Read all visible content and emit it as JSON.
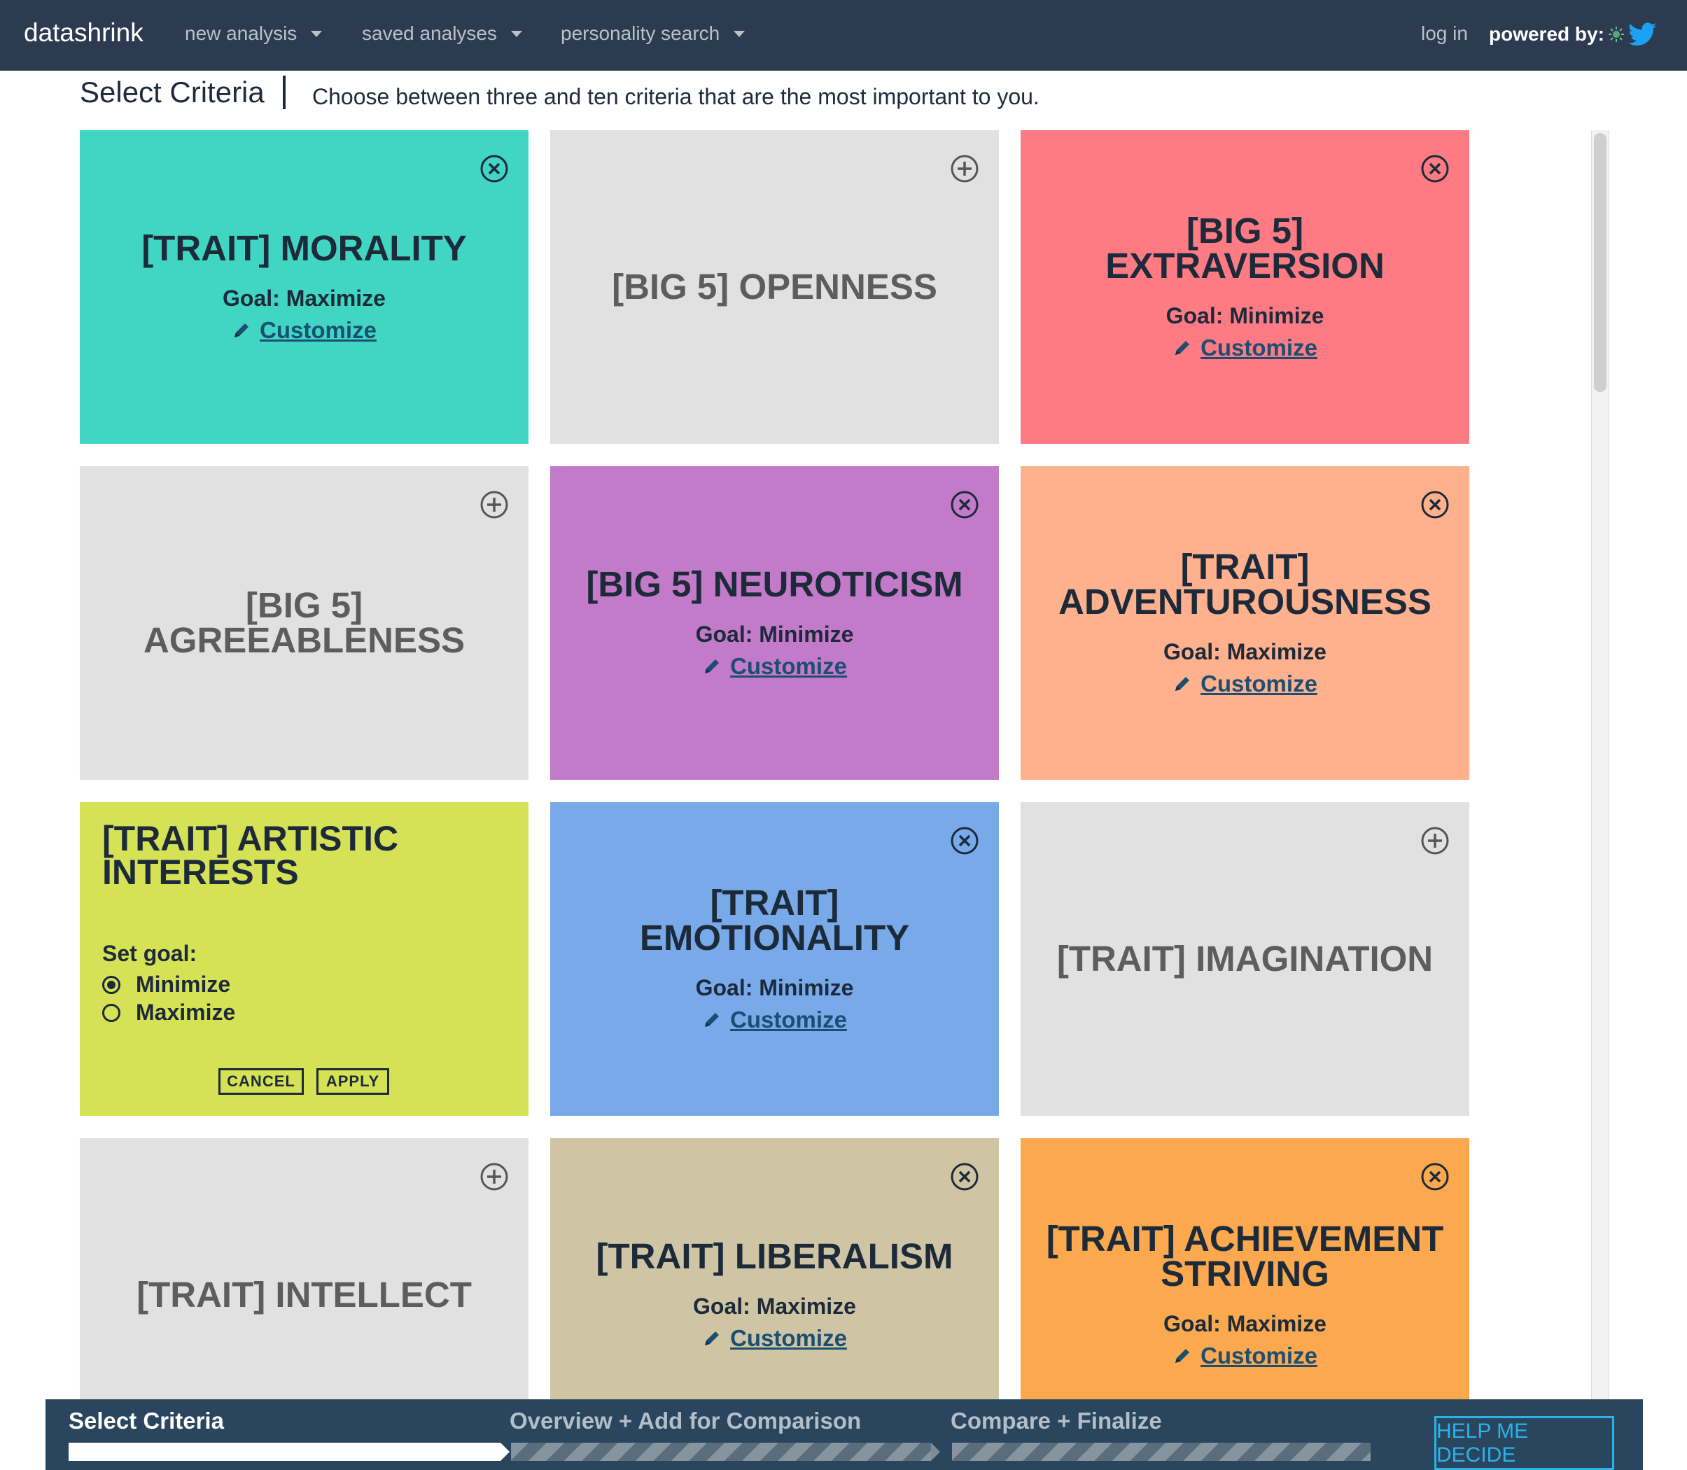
{
  "navbar": {
    "brand": "datashrink",
    "menus": [
      {
        "label": "new analysis"
      },
      {
        "label": "saved analyses"
      },
      {
        "label": "personality search"
      }
    ],
    "login": "log in",
    "powered_by": "powered by:"
  },
  "header": {
    "title": "Select Criteria",
    "subtitle": "Choose between three and ten criteria that are the most important to you."
  },
  "cards": [
    {
      "title": "[TRAIT] MORALITY",
      "goal": "Goal: Maximize",
      "customize": "Customize",
      "selected": true,
      "color": "#41d6c3"
    },
    {
      "title": "[BIG 5] OPENNESS",
      "selected": false,
      "color": "#e1e1e1"
    },
    {
      "title": "[BIG 5] EXTRAVERSION",
      "goal": "Goal: Minimize",
      "customize": "Customize",
      "selected": true,
      "color": "#ff7b84"
    },
    {
      "title": "[BIG 5] AGREEABLENESS",
      "selected": false,
      "color": "#e1e1e1"
    },
    {
      "title": "[BIG 5] NEUROTICISM",
      "goal": "Goal: Minimize",
      "customize": "Customize",
      "selected": true,
      "color": "#c37ac9"
    },
    {
      "title": "[TRAIT] ADVENTUROUSNESS",
      "goal": "Goal: Maximize",
      "customize": "Customize",
      "selected": true,
      "color": "#ffb18e"
    },
    {
      "title": "[TRAIT] ARTISTIC INTERESTS",
      "editing": true,
      "set_goal": "Set goal:",
      "options": [
        "Minimize",
        "Maximize"
      ],
      "selected_option": "Minimize",
      "cancel": "CANCEL",
      "apply": "APPLY",
      "color": "#d6e256"
    },
    {
      "title": "[TRAIT] EMOTIONALITY",
      "goal": "Goal: Minimize",
      "customize": "Customize",
      "selected": true,
      "color": "#78aaea"
    },
    {
      "title": "[TRAIT] IMAGINATION",
      "selected": false,
      "color": "#e1e1e1"
    },
    {
      "title": "[TRAIT] INTELLECT",
      "selected": false,
      "color": "#e1e1e1"
    },
    {
      "title": "[TRAIT] LIBERALISM",
      "goal": "Goal: Maximize",
      "customize": "Customize",
      "selected": true,
      "color": "#cfc4a3"
    },
    {
      "title": "[TRAIT] ACHIEVEMENT STRIVING",
      "goal": "Goal: Maximize",
      "customize": "Customize",
      "selected": true,
      "color": "#fba84f"
    }
  ],
  "footer": {
    "steps": [
      {
        "label": "Select Criteria",
        "done": true
      },
      {
        "label": "Overview + Add for Comparison",
        "done": false
      },
      {
        "label": "Compare + Finalize",
        "done": false
      }
    ],
    "help_button": "HELP ME DECIDE"
  }
}
